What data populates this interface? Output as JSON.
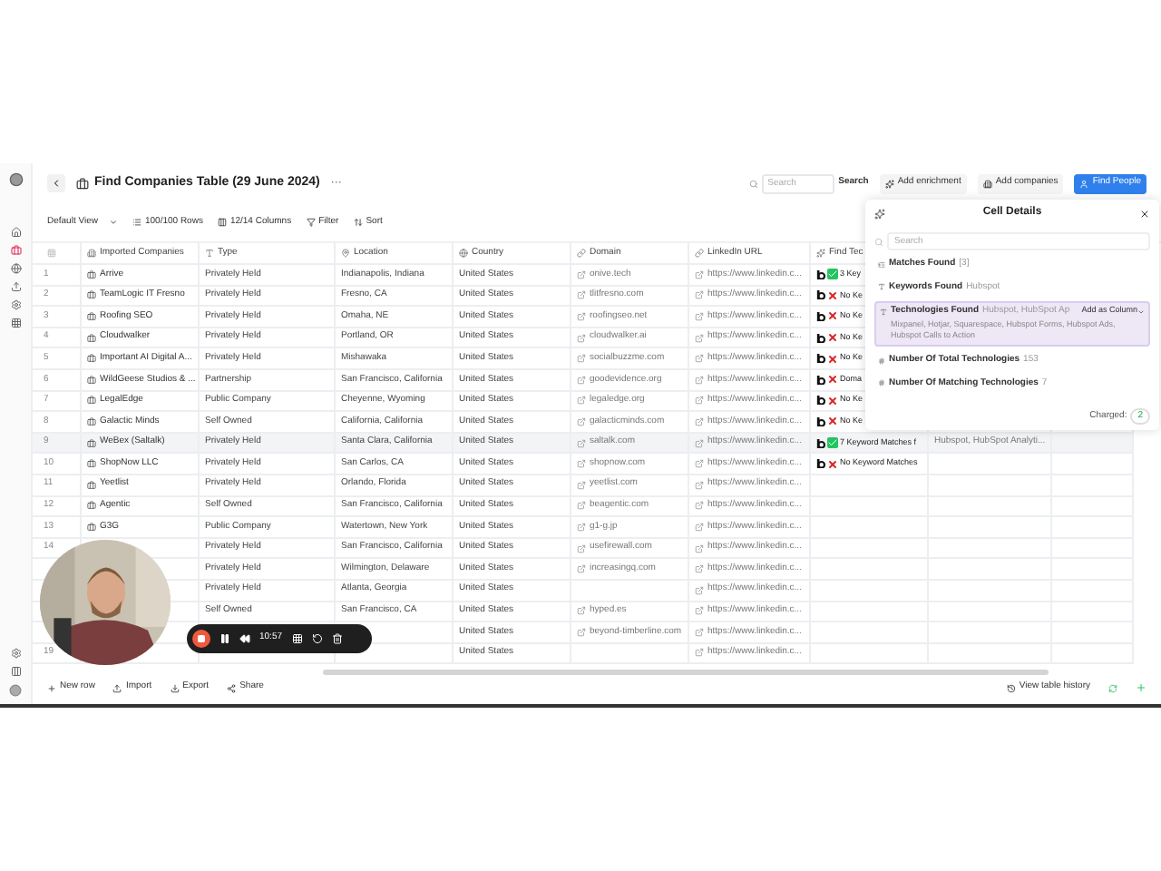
{
  "title": "Find Companies Table (29 June 2024)",
  "title_more": "···",
  "header": {
    "search": {
      "placeholder": "Search",
      "button": "Search"
    },
    "buttons": [
      {
        "label": "Add enrichment",
        "primary": false
      },
      {
        "label": "Add companies",
        "primary": false
      },
      {
        "label": "Find People",
        "primary": true
      }
    ]
  },
  "toolbar": {
    "view": "Default View",
    "rows": "100/100 Rows",
    "columns": "12/14 Columns",
    "filter": "Filter",
    "sort": "Sort"
  },
  "table": {
    "columns": [
      "Imported Companies",
      "Type",
      "Location",
      "Country",
      "Domain",
      "LinkedIn URL",
      "Find Tec"
    ],
    "rows": [
      {
        "n": "1",
        "name": "Arrive",
        "type": "Privately Held",
        "location": "Indianapolis, Indiana",
        "country": "United States",
        "domain": "onive.tech",
        "linkedin": "https://www.linkedin.c...",
        "tech": {
          "kind": "match",
          "text": "3 Key"
        },
        "selected": false
      },
      {
        "n": "2",
        "name": "TeamLogic IT Fresno",
        "type": "Privately Held",
        "location": "Fresno, CA",
        "country": "United States",
        "domain": "tlitfresno.com",
        "linkedin": "https://www.linkedin.c...",
        "tech": {
          "kind": "none",
          "text": "No Ke"
        },
        "selected": false
      },
      {
        "n": "3",
        "name": "Roofing SEO",
        "type": "Privately Held",
        "location": "Omaha, NE",
        "country": "United States",
        "domain": "roofingseo.net",
        "linkedin": "https://www.linkedin.c...",
        "tech": {
          "kind": "none",
          "text": "No Ke"
        },
        "selected": false
      },
      {
        "n": "4",
        "name": "Cloudwalker",
        "type": "Privately Held",
        "location": "Portland, OR",
        "country": "United States",
        "domain": "cloudwalker.ai",
        "linkedin": "https://www.linkedin.c...",
        "tech": {
          "kind": "none",
          "text": "No Ke"
        },
        "selected": false
      },
      {
        "n": "5",
        "name": "Important AI Digital A...",
        "type": "Privately Held",
        "location": "Mishawaka",
        "country": "United States",
        "domain": "socialbuzzme.com",
        "linkedin": "https://www.linkedin.c...",
        "tech": {
          "kind": "none",
          "text": "No Ke"
        },
        "selected": false
      },
      {
        "n": "6",
        "name": "WildGeese Studios & ...",
        "type": "Partnership",
        "location": "San Francisco, California",
        "country": "United States",
        "domain": "goodevidence.org",
        "linkedin": "https://www.linkedin.c...",
        "tech": {
          "kind": "none",
          "text": "Doma"
        },
        "selected": false
      },
      {
        "n": "7",
        "name": "LegalEdge",
        "type": "Public Company",
        "location": "Cheyenne, Wyoming",
        "country": "United States",
        "domain": "legaledge.org",
        "linkedin": "https://www.linkedin.c...",
        "tech": {
          "kind": "none",
          "text": "No Ke"
        },
        "selected": false
      },
      {
        "n": "8",
        "name": "Galactic Minds",
        "type": "Self Owned",
        "location": "California, California",
        "country": "United States",
        "domain": "galacticminds.com",
        "linkedin": "https://www.linkedin.c...",
        "tech": {
          "kind": "none",
          "text": "No Ke"
        },
        "selected": false
      },
      {
        "n": "9",
        "name": "WeBex (Saltalk)",
        "type": "Privately Held",
        "location": "Santa Clara, California",
        "country": "United States",
        "domain": "saltalk.com",
        "linkedin": "https://www.linkedin.c...",
        "tech": {
          "kind": "match",
          "text": "7 Keyword Matches f"
        },
        "extra": "Hubspot, HubSpot Analyti...",
        "selected": true
      },
      {
        "n": "10",
        "name": "ShopNow LLC",
        "type": "Privately Held",
        "location": "San Carlos, CA",
        "country": "United States",
        "domain": "shopnow.com",
        "linkedin": "https://www.linkedin.c...",
        "tech": {
          "kind": "none",
          "text": "No Keyword Matches"
        },
        "selected": false
      },
      {
        "n": "11",
        "name": "Yeetlist",
        "type": "Privately Held",
        "location": "Orlando, Florida",
        "country": "United States",
        "domain": "yeetlist.com",
        "linkedin": "https://www.linkedin.c...",
        "selected": false
      },
      {
        "n": "12",
        "name": "Agentic",
        "type": "Self Owned",
        "location": "San Francisco, California",
        "country": "United States",
        "domain": "beagentic.com",
        "linkedin": "https://www.linkedin.c...",
        "selected": false
      },
      {
        "n": "13",
        "name": "G3G",
        "type": "Public Company",
        "location": "Watertown, New York",
        "country": "United States",
        "domain": "g1-g.jp",
        "linkedin": "https://www.linkedin.c...",
        "selected": false
      },
      {
        "n": "14",
        "type": "Privately Held",
        "location": "San Francisco, California",
        "country": "United States",
        "domain": "usefirewall.com",
        "linkedin": "https://www.linkedin.c...",
        "selected": false
      },
      {
        "type": "Privately Held",
        "location": "Wilmington, Delaware",
        "country": "United States",
        "domain": "increasingq.com",
        "linkedin": "https://www.linkedin.c...",
        "selected": false
      },
      {
        "type": "Privately Held",
        "location": "Atlanta, Georgia",
        "country": "United States",
        "linkedin": "https://www.linkedin.c...",
        "selected": false
      },
      {
        "type": "Self Owned",
        "location": "San Francisco, CA",
        "country": "United States",
        "domain": "hyped.es",
        "linkedin": "https://www.linkedin.c...",
        "selected": false
      },
      {
        "country": "United States",
        "domain": "beyond-timberline.com",
        "linkedin": "https://www.linkedin.c...",
        "selected": false
      },
      {
        "n": "19",
        "country": "United States",
        "linkedin": "https://www.linkedin.c...",
        "selected": false
      }
    ]
  },
  "panel": {
    "title": "Cell Details",
    "search": {
      "placeholder": "Search"
    },
    "items": [
      {
        "kind": "list",
        "label": "Matches Found",
        "value": "[3]",
        "highlighted": false
      },
      {
        "kind": "text",
        "label": "Keywords Found",
        "value": "Hubspot",
        "highlighted": false
      },
      {
        "kind": "text",
        "label": "Technologies Found",
        "value": "Hubspot, HubSpot Ap",
        "action": "Add as Column",
        "more": "Mixpanel, Hotjar, Squarespace, Hubspot Forms, Hubspot Ads, Hubspot Calls to Action",
        "highlighted": true
      },
      {
        "kind": "number",
        "label": "Number Of Total Technologies",
        "value": "153",
        "highlighted": false
      },
      {
        "kind": "number",
        "label": "Number Of Matching Technologies",
        "value": "7",
        "highlighted": false
      }
    ],
    "charged_label": "Charged:",
    "charged": "2"
  },
  "recorder": {
    "time": "10:57"
  },
  "footer": {
    "left": [
      "New row",
      "Import",
      "Export",
      "Share"
    ],
    "history": "View table history"
  }
}
